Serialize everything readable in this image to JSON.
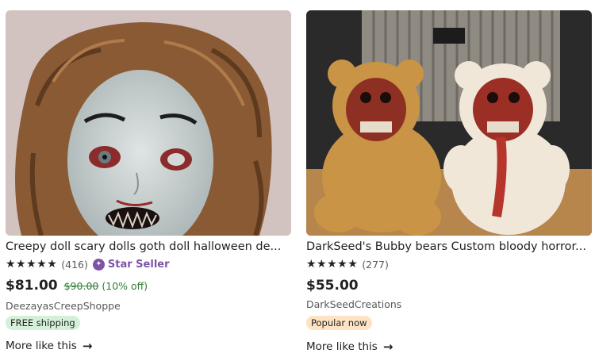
{
  "listings": [
    {
      "title": "Creepy doll scary dolls goth doll halloween de...",
      "stars": "★★★★★",
      "review_count": "(416)",
      "star_seller": "Star Seller",
      "price": "$81.00",
      "original_price": "$90.00",
      "discount": "(10% off)",
      "shop": "DeezayasCreepShoppe",
      "badge": "FREE shipping",
      "more_link": "More like this",
      "image_icon": "creepy-doll-photo"
    },
    {
      "title": "DarkSeed's Bubby bears Custom bloody horror...",
      "stars": "★★★★★",
      "review_count": "(277)",
      "price": "$55.00",
      "shop": "DarkSeedCreations",
      "badge": "Popular now",
      "more_link": "More like this",
      "image_icon": "bloody-teddy-bears-photo"
    }
  ],
  "colors": {
    "star_seller": "#7d53a6",
    "discount_green": "#2e7d32",
    "free_shipping_bg": "#d4f0d9",
    "popular_bg": "#fde2c3"
  }
}
